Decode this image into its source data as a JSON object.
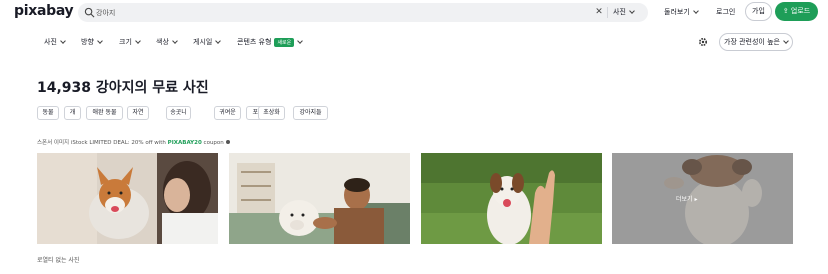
{
  "header": {
    "logo": "pixabay",
    "search_value": "강아지",
    "search_category": "사진",
    "explore": "둘러보기",
    "login": "로그인",
    "join": "가입",
    "upload": "업로드"
  },
  "filters": {
    "items": [
      "사진",
      "방향",
      "크기",
      "색상",
      "게시일"
    ],
    "content_credentials": "콘텐츠 유형",
    "new_badge": "새로운",
    "sort": "가장 관련성이 높은"
  },
  "heading": "14,938 강아지의 무료 사진",
  "tags": [
    "동물",
    "개",
    "애완 동물",
    "자연",
    "송곳니",
    "귀여운",
    "포유 동물",
    "초상화",
    "강아지들"
  ],
  "sponsor": {
    "text": "스폰서 이미지 iStock LIMITED DEAL: 20% off with ",
    "code": "PIXABAY20",
    "suffix": " coupon"
  },
  "photos": {
    "more_label": "더보기 ▸"
  },
  "footer_label": "로열티 없는 사진",
  "colors": {
    "brand_green": "#1e9e58",
    "text": "#191b26"
  }
}
